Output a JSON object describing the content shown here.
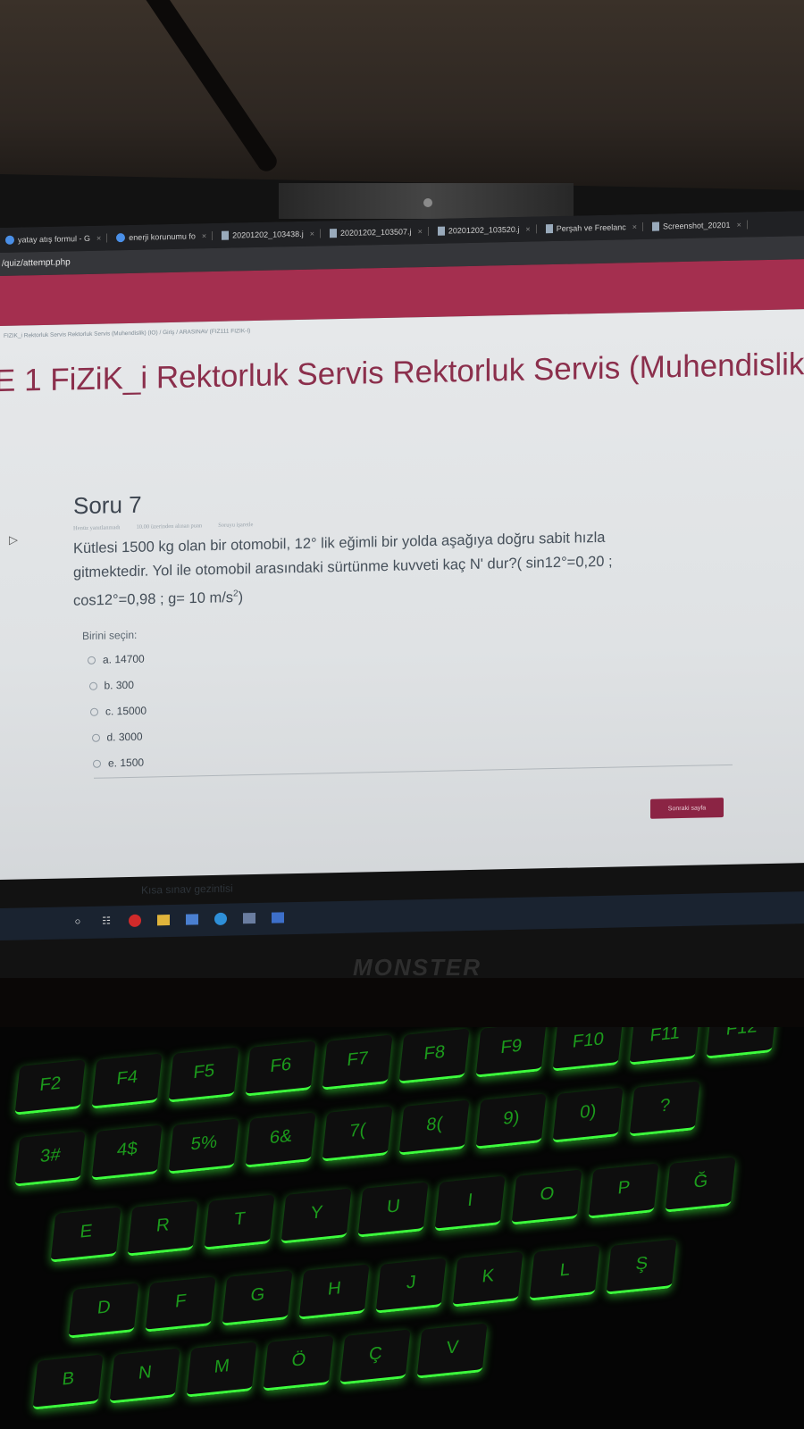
{
  "browser": {
    "tabs": [
      {
        "label": "yatay atış formul - G",
        "icon": "google-icon"
      },
      {
        "label": "enerji korunumu fo",
        "icon": "google-icon"
      },
      {
        "label": "20201202_103438.j",
        "icon": "document-icon"
      },
      {
        "label": "20201202_103507.j",
        "icon": "document-icon"
      },
      {
        "label": "20201202_103520.j",
        "icon": "document-icon"
      },
      {
        "label": "Perşah ve Freelanc",
        "icon": "document-icon"
      },
      {
        "label": "Screenshot_20201",
        "icon": "document-icon"
      }
    ],
    "url": "/quiz/attempt.php"
  },
  "breadcrumb": "FIZIK_i Rektorluk Servis Rektorluk Servis (Muhendislik) (IO)  /  Giriş  /  ARASINAV (FIZ111 FIZIK-I)",
  "course_title": "E 1 FiZiK_i Rektorluk Servis Rektorluk Servis (Muhendislik) (i",
  "question": {
    "title": "Soru 7",
    "status": "Henüz yanıtlanmadı",
    "points": "10.00 üzerinden alınan puan",
    "flag": "Soruyu işaretle",
    "text_line1": "Kütlesi 1500 kg olan bir otomobil, 12° lik eğimli bir yolda aşağıya doğru sabit hızla",
    "text_line2": "gitmektedir. Yol ile otomobil arasındaki sürtünme kuvveti kaç N' dur?( sin12°=0,20 ;",
    "text_line3a": "cos12°=0,98  ; g= 10 m/s",
    "text_line3_sup": "2",
    "text_line3b": ")",
    "choose_label": "Birini seçin:",
    "answers": [
      {
        "label": "a. 14700"
      },
      {
        "label": "b. 300"
      },
      {
        "label": "c. 15000"
      },
      {
        "label": "d. 3000"
      },
      {
        "label": "e. 1500"
      }
    ]
  },
  "next_button": "Sonraki sayfa",
  "quiz_nav": "Kısa sınav gezintisi",
  "laptop_brand": "MONSTER",
  "keyboard_keys": [
    "F2",
    "F4",
    "F5",
    "F6",
    "F7",
    "F8",
    "F9",
    "F10",
    "F11",
    "F12",
    "3#",
    "4$",
    "5%",
    "6&",
    "7(",
    "8(",
    "9)",
    "0)",
    "?",
    "E",
    "R",
    "T",
    "Y",
    "U",
    "I",
    "O",
    "P",
    "Ğ",
    "D",
    "F",
    "G",
    "H",
    "J",
    "K",
    "L",
    "Ş",
    "B",
    "N",
    "M",
    "Ö",
    "Ç",
    "V"
  ]
}
